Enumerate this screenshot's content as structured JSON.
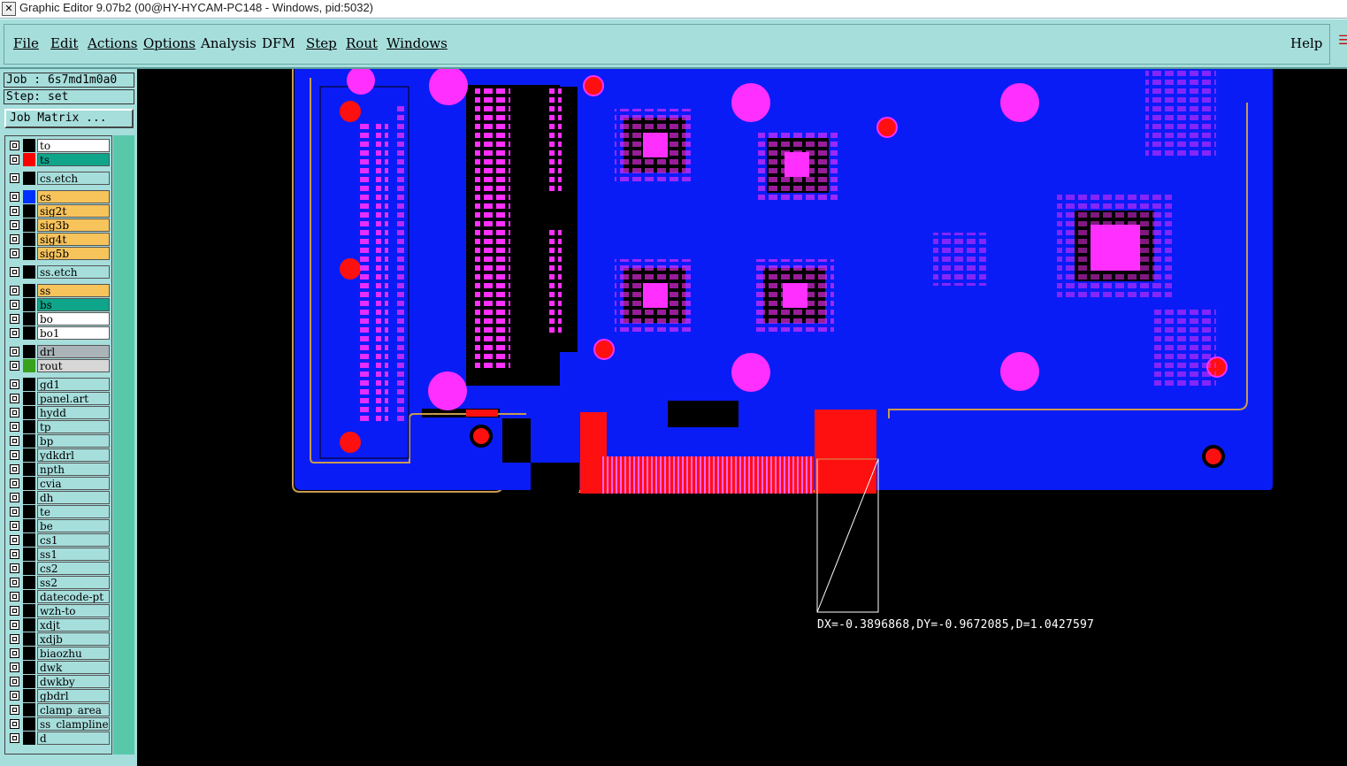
{
  "window": {
    "title": "Graphic Editor 9.07b2 (00@HY-HYCAM-PC148 - Windows, pid:5032)"
  },
  "menu": {
    "items": [
      "File",
      "Edit",
      "Actions",
      "Options",
      "Analysis",
      "DFM",
      "Step",
      "Rout",
      "Windows"
    ],
    "help": "Help"
  },
  "job": {
    "label": "Job : 6s7md1m0a0",
    "step": "Step: set",
    "matrix_button": "Job Matrix ..."
  },
  "layers": [
    {
      "name": "to",
      "bg": "#ffffff",
      "swatch": ""
    },
    {
      "name": "ts",
      "bg": "#0fa58a",
      "swatch": "#ff0000"
    },
    {
      "name": "cs.etch",
      "bg": "#a6dedc",
      "swatch": ""
    },
    {
      "name": "cs",
      "bg": "#f7c35b",
      "swatch": "#0030ff"
    },
    {
      "name": "sig2t",
      "bg": "#f7c35b",
      "swatch": ""
    },
    {
      "name": "sig3b",
      "bg": "#f7c35b",
      "swatch": ""
    },
    {
      "name": "sig4t",
      "bg": "#f7c35b",
      "swatch": ""
    },
    {
      "name": "sig5b",
      "bg": "#f7c35b",
      "swatch": ""
    },
    {
      "name": "ss.etch",
      "bg": "#a6dedc",
      "swatch": ""
    },
    {
      "name": "ss",
      "bg": "#f7c35b",
      "swatch": ""
    },
    {
      "name": "bs",
      "bg": "#0fa58a",
      "swatch": ""
    },
    {
      "name": "bo",
      "bg": "#ffffff",
      "swatch": ""
    },
    {
      "name": "bo1",
      "bg": "#ffffff",
      "swatch": ""
    },
    {
      "name": "drl",
      "bg": "#a9b3b8",
      "swatch": ""
    },
    {
      "name": "rout",
      "bg": "#d7d7d7",
      "swatch": "#39a21c"
    },
    {
      "name": "gd1",
      "bg": "#a6dedc",
      "swatch": ""
    },
    {
      "name": "panel.art",
      "bg": "#a6dedc",
      "swatch": ""
    },
    {
      "name": "hydd",
      "bg": "#a6dedc",
      "swatch": ""
    },
    {
      "name": "tp",
      "bg": "#a6dedc",
      "swatch": ""
    },
    {
      "name": "bp",
      "bg": "#a6dedc",
      "swatch": ""
    },
    {
      "name": "ydkdrl",
      "bg": "#a6dedc",
      "swatch": ""
    },
    {
      "name": "npth",
      "bg": "#a6dedc",
      "swatch": ""
    },
    {
      "name": "cvia",
      "bg": "#a6dedc",
      "swatch": ""
    },
    {
      "name": "dh",
      "bg": "#a6dedc",
      "swatch": ""
    },
    {
      "name": "te",
      "bg": "#a6dedc",
      "swatch": ""
    },
    {
      "name": "be",
      "bg": "#a6dedc",
      "swatch": ""
    },
    {
      "name": "cs1",
      "bg": "#a6dedc",
      "swatch": ""
    },
    {
      "name": "ss1",
      "bg": "#a6dedc",
      "swatch": ""
    },
    {
      "name": "cs2",
      "bg": "#a6dedc",
      "swatch": ""
    },
    {
      "name": "ss2",
      "bg": "#a6dedc",
      "swatch": ""
    },
    {
      "name": "datecode-pt",
      "bg": "#a6dedc",
      "swatch": ""
    },
    {
      "name": "wzh-to",
      "bg": "#a6dedc",
      "swatch": ""
    },
    {
      "name": "xdjt",
      "bg": "#a6dedc",
      "swatch": ""
    },
    {
      "name": "xdjb",
      "bg": "#a6dedc",
      "swatch": ""
    },
    {
      "name": "biaozhu",
      "bg": "#a6dedc",
      "swatch": ""
    },
    {
      "name": "dwk",
      "bg": "#a6dedc",
      "swatch": ""
    },
    {
      "name": "dwkby",
      "bg": "#a6dedc",
      "swatch": ""
    },
    {
      "name": "gbdrl",
      "bg": "#a6dedc",
      "swatch": ""
    },
    {
      "name": "clamp_area",
      "bg": "#a6dedc",
      "swatch": ""
    },
    {
      "name": "ss_clampline",
      "bg": "#a6dedc",
      "swatch": ""
    },
    {
      "name": "d",
      "bg": "#a6dedc",
      "swatch": ""
    }
  ],
  "measurement": {
    "readout": "DX=-0.3896868,DY=-0.9672085,D=1.0427597"
  },
  "colors": {
    "board": "#0a1cf5",
    "pad": "#ff30ff",
    "copper": "#ff1010",
    "outline": "#c89a50",
    "panel": "#a6dedc"
  }
}
